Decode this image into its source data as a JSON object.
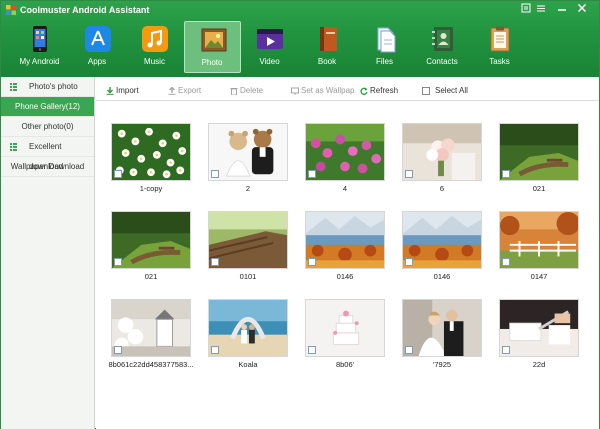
{
  "app": {
    "title": "Coolmuster Android Assistant"
  },
  "nav": [
    {
      "label": "My Android",
      "icon": "phone-icon"
    },
    {
      "label": "Apps",
      "icon": "app-store-icon"
    },
    {
      "label": "Music",
      "icon": "music-icon"
    },
    {
      "label": "Photo",
      "icon": "photo-icon",
      "active": true
    },
    {
      "label": "Video",
      "icon": "video-icon"
    },
    {
      "label": "Book",
      "icon": "book-icon"
    },
    {
      "label": "Files",
      "icon": "files-icon"
    },
    {
      "label": "Contacts",
      "icon": "contacts-icon"
    },
    {
      "label": "Tasks",
      "icon": "tasks-icon"
    }
  ],
  "sidebar": {
    "items": [
      {
        "label": "Photo's photo"
      },
      {
        "label": "Phone Gallery(12)"
      },
      {
        "label": "Other photo(0)"
      },
      {
        "label": "Excellent download"
      },
      {
        "label": "Wallpaper Download"
      }
    ]
  },
  "toolbar": {
    "import": "Import",
    "export": "Export",
    "delete": "Delete",
    "wallpaper": "Set as Wallpap",
    "refresh": "Refresh",
    "select_all": "Select All"
  },
  "photos": [
    {
      "caption": "1-copy",
      "scene": "daisies"
    },
    {
      "caption": "2",
      "scene": "teddy"
    },
    {
      "caption": "4",
      "scene": "flowers"
    },
    {
      "caption": "6",
      "scene": "bouquet"
    },
    {
      "caption": "021",
      "scene": "park"
    },
    {
      "caption": "021",
      "scene": "park"
    },
    {
      "caption": "0101",
      "scene": "bench"
    },
    {
      "caption": "0146",
      "scene": "autumn-lake"
    },
    {
      "caption": "0146",
      "scene": "autumn-lake"
    },
    {
      "caption": "0147",
      "scene": "fence"
    },
    {
      "caption": "8b061c22dd458377583...",
      "scene": "gazebo"
    },
    {
      "caption": "Koala",
      "scene": "beach-couple"
    },
    {
      "caption": "8b06'",
      "scene": "cake"
    },
    {
      "caption": "'7925",
      "scene": "wedding-couple"
    },
    {
      "caption": "22d",
      "scene": "cake-cut"
    }
  ],
  "colors": {
    "brand": "#21933f",
    "accent": "#3aa552",
    "nav_active": "#6cbf7c"
  }
}
